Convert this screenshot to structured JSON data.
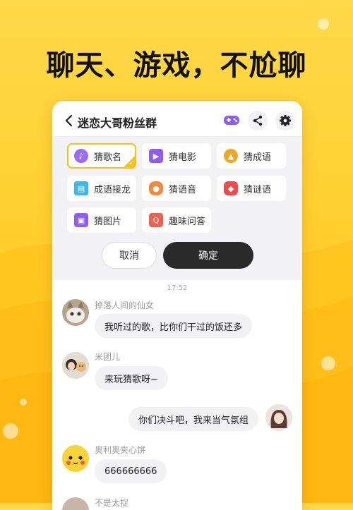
{
  "headline": "聊天、游戏，不尬聊",
  "header": {
    "title": "迷恋大哥粉丝群",
    "icons": [
      "back-arrow-icon",
      "game-controller-icon",
      "share-icon",
      "gear-icon"
    ]
  },
  "games": [
    {
      "label": "猜歌名",
      "icon": "microphone-icon",
      "color": "#9a6bff",
      "selected": true
    },
    {
      "label": "猜电影",
      "icon": "video-camera-icon",
      "color": "#8e5cf7",
      "selected": false
    },
    {
      "label": "猜成语",
      "icon": "graduation-cap-icon",
      "color": "#f2a623",
      "selected": false
    },
    {
      "label": "成语接龙",
      "icon": "dragon-card-icon",
      "color": "#3fb6f0",
      "selected": false
    },
    {
      "label": "猜语音",
      "icon": "voice-bubble-icon",
      "color": "#f28a3b",
      "selected": false
    },
    {
      "label": "猜谜语",
      "icon": "lantern-icon",
      "color": "#f04b4b",
      "selected": false
    },
    {
      "label": "猜图片",
      "icon": "picture-icon",
      "color": "#8e5cf7",
      "selected": false
    },
    {
      "label": "趣味问答",
      "icon": "qa-icon",
      "color": "#f06050",
      "selected": false
    }
  ],
  "actions": {
    "cancel": "取消",
    "confirm": "确定"
  },
  "chat": {
    "time": "17:52",
    "messages": [
      {
        "user": "掉落人间的仙女",
        "text": "我听过的歌，比你们干过的饭还多",
        "avatar": "cat-avatar"
      },
      {
        "user": "米团儿",
        "text": "来玩猜歌呀~",
        "avatar": "girl-with-dog-avatar"
      },
      {
        "user": "",
        "text": "你们决斗吧，我来当气氛组",
        "avatar": "self-avatar"
      },
      {
        "user": "奥利奥夹心饼",
        "text": "666666666",
        "avatar": "pikachu-avatar"
      },
      {
        "user": "不是太捉",
        "text": "",
        "avatar": "user-avatar"
      }
    ]
  }
}
